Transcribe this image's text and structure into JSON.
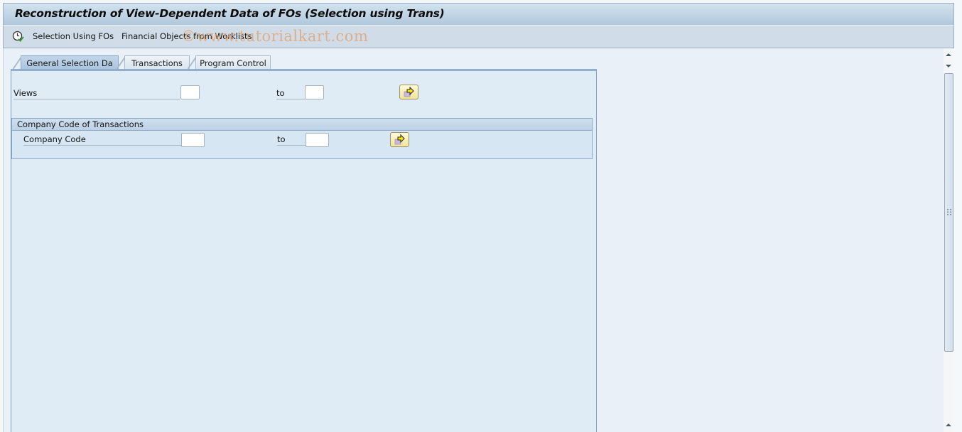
{
  "window": {
    "title": "Reconstruction of View-Dependent Data of FOs (Selection using Trans)"
  },
  "toolbar": {
    "items": [
      {
        "label": "Selection Using FOs",
        "icon": "execute-clock-icon"
      },
      {
        "label": "Financial Objects from Worklists"
      }
    ]
  },
  "watermark": "©www.tutorialkart.com",
  "tabs": [
    {
      "label": "General Selection Da",
      "active": true
    },
    {
      "label": "Transactions",
      "active": false
    },
    {
      "label": "Program Control",
      "active": false
    }
  ],
  "selection": {
    "views": {
      "label": "Views",
      "from_value": "",
      "to_label": "to",
      "to_value": "",
      "more_icon": "multiple-selection-arrow-icon"
    },
    "company_group": {
      "title": "Company Code of Transactions",
      "company_code": {
        "label": "Company Code",
        "from_value": "",
        "to_label": "to",
        "to_value": "",
        "more_icon": "multiple-selection-arrow-icon"
      }
    }
  },
  "colors": {
    "panel_bg": "#dfebf5",
    "title_gradient_top": "#d3e2ee",
    "title_gradient_bottom": "#b0c8dd",
    "button_yellow": "#f2e49a",
    "active_tab": "#a9c4de"
  }
}
